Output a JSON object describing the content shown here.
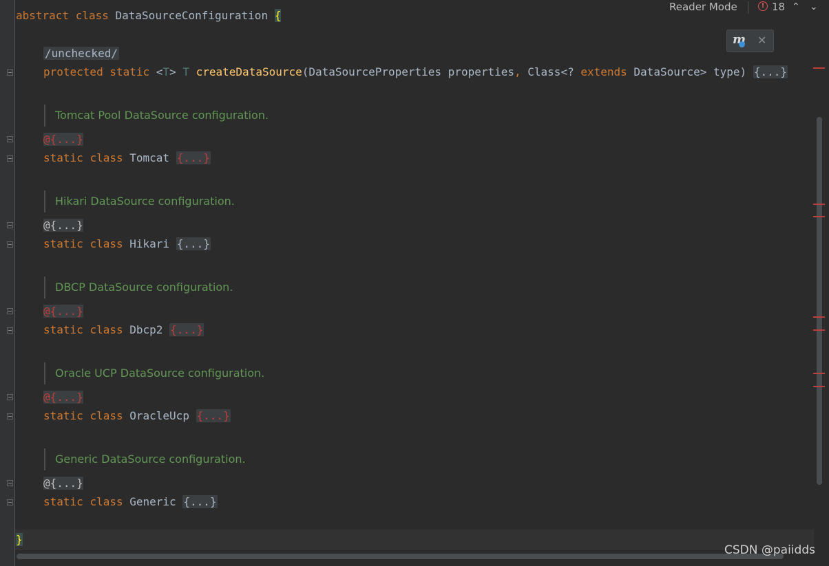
{
  "toolbar": {
    "reader_mode": "Reader Mode",
    "error_count": "18",
    "error_icon": "!",
    "up_arrow": "⌃",
    "down_arrow": "⌄"
  },
  "popup": {
    "icon": "m",
    "close": "✕"
  },
  "code": {
    "line1": {
      "kw1": "abstract",
      "kw2": "class",
      "name": "DataSourceConfiguration",
      "brace": "{"
    },
    "comment_tag": "/unchecked/",
    "line_create": {
      "kw1": "protected",
      "kw2": "static",
      "lt": "<",
      "T1": "T",
      "gt": ">",
      "T2": "T",
      "fn": "createDataSource",
      "params_a": "(DataSourceProperties properties",
      "comma": ",",
      "params_b": " Class<? ",
      "kw3": "extends",
      "params_c": " DataSource> type) ",
      "fold": "{...}"
    },
    "blocks": [
      {
        "doc": "Tomcat Pool DataSource configuration.",
        "annotation": "@{...}",
        "ann_error": true,
        "kw1": "static",
        "kw2": "class",
        "name": "Tomcat",
        "fold": "{...}",
        "fold_error": true
      },
      {
        "doc": "Hikari DataSource configuration.",
        "annotation": "@{...}",
        "ann_error": false,
        "kw1": "static",
        "kw2": "class",
        "name": "Hikari",
        "fold": "{...}",
        "fold_error": false
      },
      {
        "doc": "DBCP DataSource configuration.",
        "annotation": "@{...}",
        "ann_error": true,
        "kw1": "static",
        "kw2": "class",
        "name": "Dbcp2",
        "fold": "{...}",
        "fold_error": true
      },
      {
        "doc": "Oracle UCP DataSource configuration.",
        "annotation": "@{...}",
        "ann_error": true,
        "kw1": "static",
        "kw2": "class",
        "name": "OracleUcp",
        "fold": "{...}",
        "fold_error": true
      },
      {
        "doc": "Generic DataSource configuration.",
        "annotation": "@{...}",
        "ann_error": false,
        "kw1": "static",
        "kw2": "class",
        "name": "Generic",
        "fold": "{...}",
        "fold_error": false
      }
    ],
    "closing_brace": "}"
  },
  "watermark": "CSDN @paiidds",
  "colors": {
    "background": "#2b2b2b",
    "keyword": "#cc7832",
    "function": "#ffc66d",
    "doc_comment": "#629755",
    "error": "#bc3f3c"
  }
}
